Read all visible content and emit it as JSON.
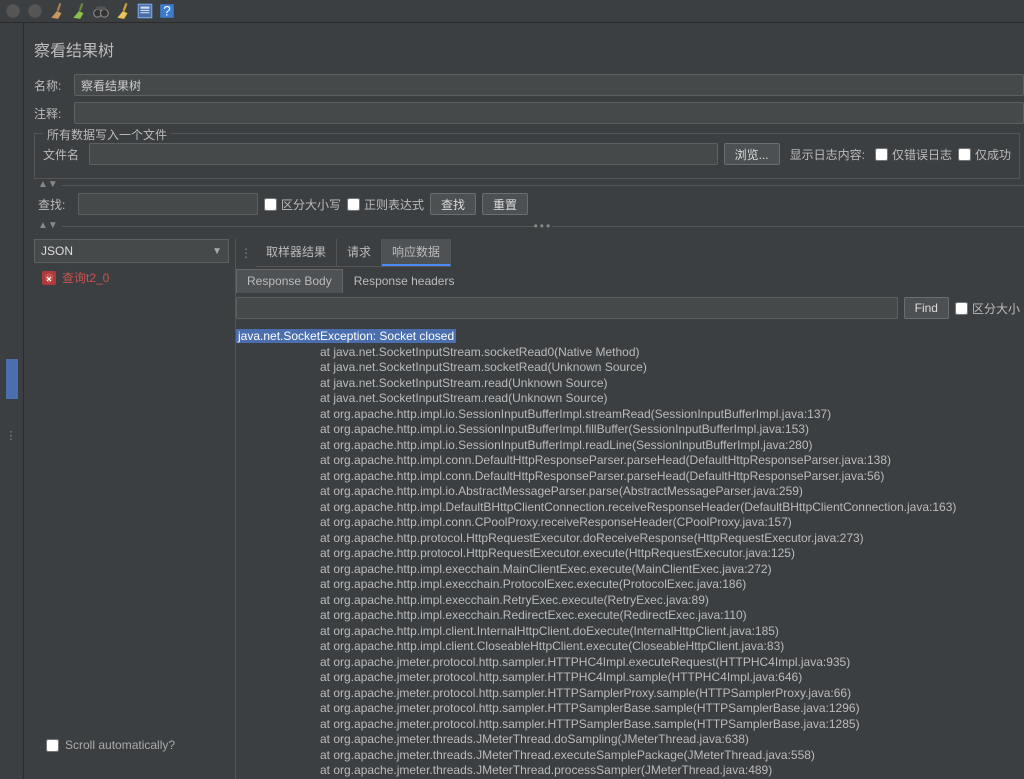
{
  "toolbar_icons": [
    "disabled-circle-1",
    "disabled-circle-2",
    "broom-brown",
    "broom-green",
    "binoculars",
    "broom-yellow",
    "template-icon",
    "help-icon"
  ],
  "title": "察看结果树",
  "name_label": "名称:",
  "name_value": "察看结果树",
  "comment_label": "注释:",
  "comment_value": "",
  "writefile": {
    "legend": "所有数据写入一个文件",
    "filename_label": "文件名",
    "filename_value": "",
    "browse": "浏览...",
    "showlog_label": "显示日志内容:",
    "only_error": "仅错误日志",
    "only_success": "仅成功"
  },
  "search_row": {
    "label": "查找:",
    "case_sensitive": "区分大小写",
    "regex": "正则表达式",
    "find_btn": "查找",
    "reset_btn": "重置"
  },
  "tree": {
    "format": "JSON",
    "items": [
      {
        "label": "查询t2_0"
      }
    ]
  },
  "tabs": [
    "取样器结果",
    "请求",
    "响应数据"
  ],
  "subtabs": [
    "Response Body",
    "Response headers"
  ],
  "find_btn": "Find",
  "find_case": "区分大小",
  "scroll_auto": "Scroll automatically?",
  "stacktrace": {
    "header": "java.net.SocketException: Socket closed",
    "lines": [
      "at java.net.SocketInputStream.socketRead0(Native Method)",
      "at java.net.SocketInputStream.socketRead(Unknown Source)",
      "at java.net.SocketInputStream.read(Unknown Source)",
      "at java.net.SocketInputStream.read(Unknown Source)",
      "at org.apache.http.impl.io.SessionInputBufferImpl.streamRead(SessionInputBufferImpl.java:137)",
      "at org.apache.http.impl.io.SessionInputBufferImpl.fillBuffer(SessionInputBufferImpl.java:153)",
      "at org.apache.http.impl.io.SessionInputBufferImpl.readLine(SessionInputBufferImpl.java:280)",
      "at org.apache.http.impl.conn.DefaultHttpResponseParser.parseHead(DefaultHttpResponseParser.java:138)",
      "at org.apache.http.impl.conn.DefaultHttpResponseParser.parseHead(DefaultHttpResponseParser.java:56)",
      "at org.apache.http.impl.io.AbstractMessageParser.parse(AbstractMessageParser.java:259)",
      "at org.apache.http.impl.DefaultBHttpClientConnection.receiveResponseHeader(DefaultBHttpClientConnection.java:163)",
      "at org.apache.http.impl.conn.CPoolProxy.receiveResponseHeader(CPoolProxy.java:157)",
      "at org.apache.http.protocol.HttpRequestExecutor.doReceiveResponse(HttpRequestExecutor.java:273)",
      "at org.apache.http.protocol.HttpRequestExecutor.execute(HttpRequestExecutor.java:125)",
      "at org.apache.http.impl.execchain.MainClientExec.execute(MainClientExec.java:272)",
      "at org.apache.http.impl.execchain.ProtocolExec.execute(ProtocolExec.java:186)",
      "at org.apache.http.impl.execchain.RetryExec.execute(RetryExec.java:89)",
      "at org.apache.http.impl.execchain.RedirectExec.execute(RedirectExec.java:110)",
      "at org.apache.http.impl.client.InternalHttpClient.doExecute(InternalHttpClient.java:185)",
      "at org.apache.http.impl.client.CloseableHttpClient.execute(CloseableHttpClient.java:83)",
      "at org.apache.jmeter.protocol.http.sampler.HTTPHC4Impl.executeRequest(HTTPHC4Impl.java:935)",
      "at org.apache.jmeter.protocol.http.sampler.HTTPHC4Impl.sample(HTTPHC4Impl.java:646)",
      "at org.apache.jmeter.protocol.http.sampler.HTTPSamplerProxy.sample(HTTPSamplerProxy.java:66)",
      "at org.apache.jmeter.protocol.http.sampler.HTTPSamplerBase.sample(HTTPSamplerBase.java:1296)",
      "at org.apache.jmeter.protocol.http.sampler.HTTPSamplerBase.sample(HTTPSamplerBase.java:1285)",
      "at org.apache.jmeter.threads.JMeterThread.doSampling(JMeterThread.java:638)",
      "at org.apache.jmeter.threads.JMeterThread.executeSamplePackage(JMeterThread.java:558)",
      "at org.apache.jmeter.threads.JMeterThread.processSampler(JMeterThread.java:489)"
    ]
  }
}
